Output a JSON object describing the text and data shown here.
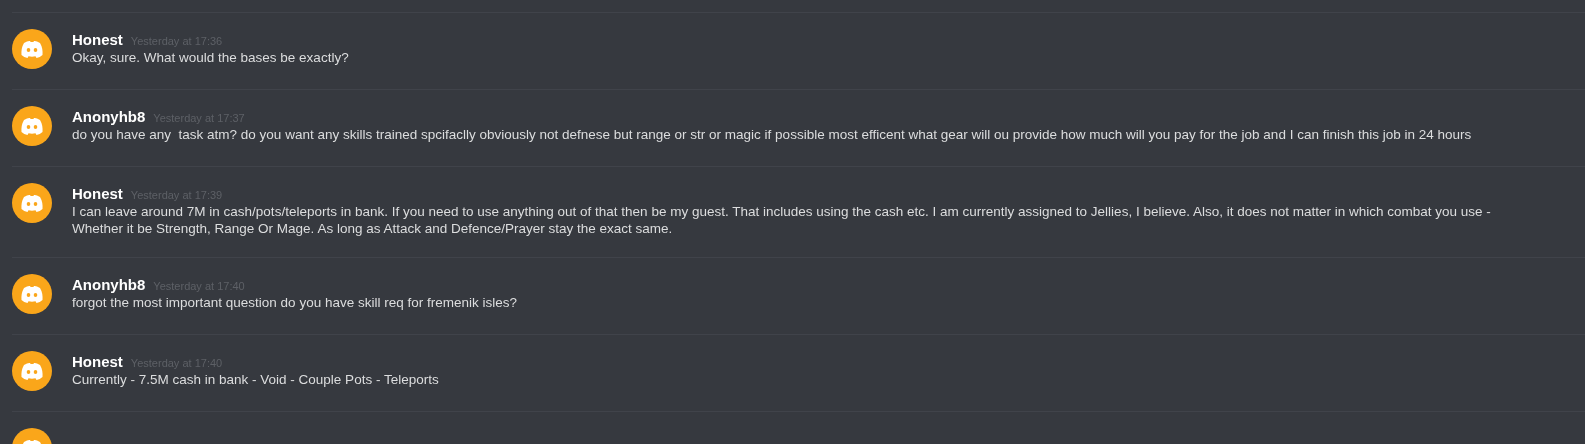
{
  "messages": [
    {
      "author": "Honest",
      "timestamp": "Yesterday at 17:36",
      "text": "Okay, sure. What would the bases be exactly?"
    },
    {
      "author": "Anonyhb8",
      "timestamp": "Yesterday at 17:37",
      "text": "do you have any  task atm? do you want any skills trained spcifaclly obviously not defnese but range or str or magic if possible most efficent what gear will ou provide how much will you pay for the job and I can finish this job in 24 hours"
    },
    {
      "author": "Honest",
      "timestamp": "Yesterday at 17:39",
      "text": "I can leave around 7M in cash/pots/teleports in bank. If you need to use anything out of that then be my guest. That includes using the cash etc. I am currently assigned to Jellies, I believe. Also, it does not matter in which combat you use - Whether it be Strength, Range Or Mage. As long as Attack and Defence/Prayer stay the exact same."
    },
    {
      "author": "Anonyhb8",
      "timestamp": "Yesterday at 17:40",
      "text": "forgot the most important question do you have skill req for fremenik isles?"
    },
    {
      "author": "Honest",
      "timestamp": "Yesterday at 17:40",
      "text": "Currently - 7.5M cash in bank - Void - Couple Pots - Teleports"
    }
  ],
  "more_below": true
}
